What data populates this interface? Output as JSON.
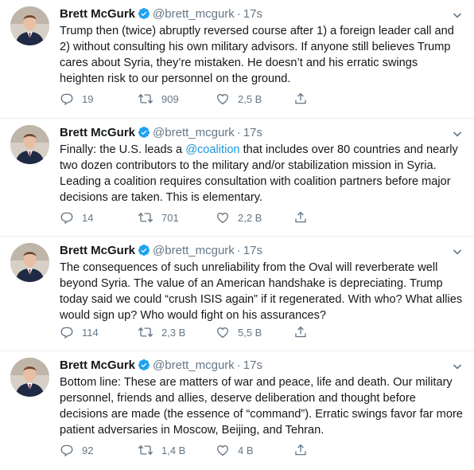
{
  "author": {
    "name": "Brett McGurk",
    "handle": "@brett_mcgurk",
    "verified": true
  },
  "separator": "·",
  "tweets": [
    {
      "time": "17s",
      "text_before": "Trump then (twice) abruptly reversed course after 1) a foreign leader call and 2) without consulting his own military advisors. If anyone still believes Trump cares about Syria, they’re mistaken. He doesn’t and his erratic swings heighten risk to our personnel on the ground.",
      "mention": "",
      "text_after": "",
      "replies": "19",
      "retweets": "909",
      "likes": "2,5 B"
    },
    {
      "time": "17s",
      "text_before": "Finally: the U.S. leads a ",
      "mention": "@coalition",
      "text_after": " that includes over 80 countries and nearly two dozen contributors to the military and/or stabilization mission in Syria. Leading a coalition requires consultation with coalition partners before major decisions are taken. This is elementary.",
      "replies": "14",
      "retweets": "701",
      "likes": "2,2 B"
    },
    {
      "time": "17s",
      "text_before": "The consequences of such unreliability from the Oval will reverberate well beyond Syria. The value of an American handshake is depreciating. Trump today said we could “crush ISIS again” if it regenerated. With who?  What allies would sign up? Who would fight on his assurances?",
      "mention": "",
      "text_after": "",
      "replies": "114",
      "retweets": "2,3 B",
      "likes": "5,5 B"
    },
    {
      "time": "17s",
      "text_before": "Bottom line: These are matters of war and peace, life and death. Our military personnel, friends and allies, deserve deliberation and thought before decisions are made (the essence of “command”). Erratic swings favor far more patient adversaries in Moscow, Beijing, and Tehran.",
      "mention": "",
      "text_after": "",
      "replies": "92",
      "retweets": "1,4 B",
      "likes": "4 B"
    }
  ],
  "colors": {
    "text": "#14171a",
    "secondary": "#657786",
    "link": "#1b95e0",
    "verified": "#1da1f2",
    "divider": "#e6ecf0"
  },
  "icons": [
    "verified-badge-icon",
    "chevron-down-icon",
    "reply-icon",
    "retweet-icon",
    "like-icon",
    "share-icon"
  ]
}
